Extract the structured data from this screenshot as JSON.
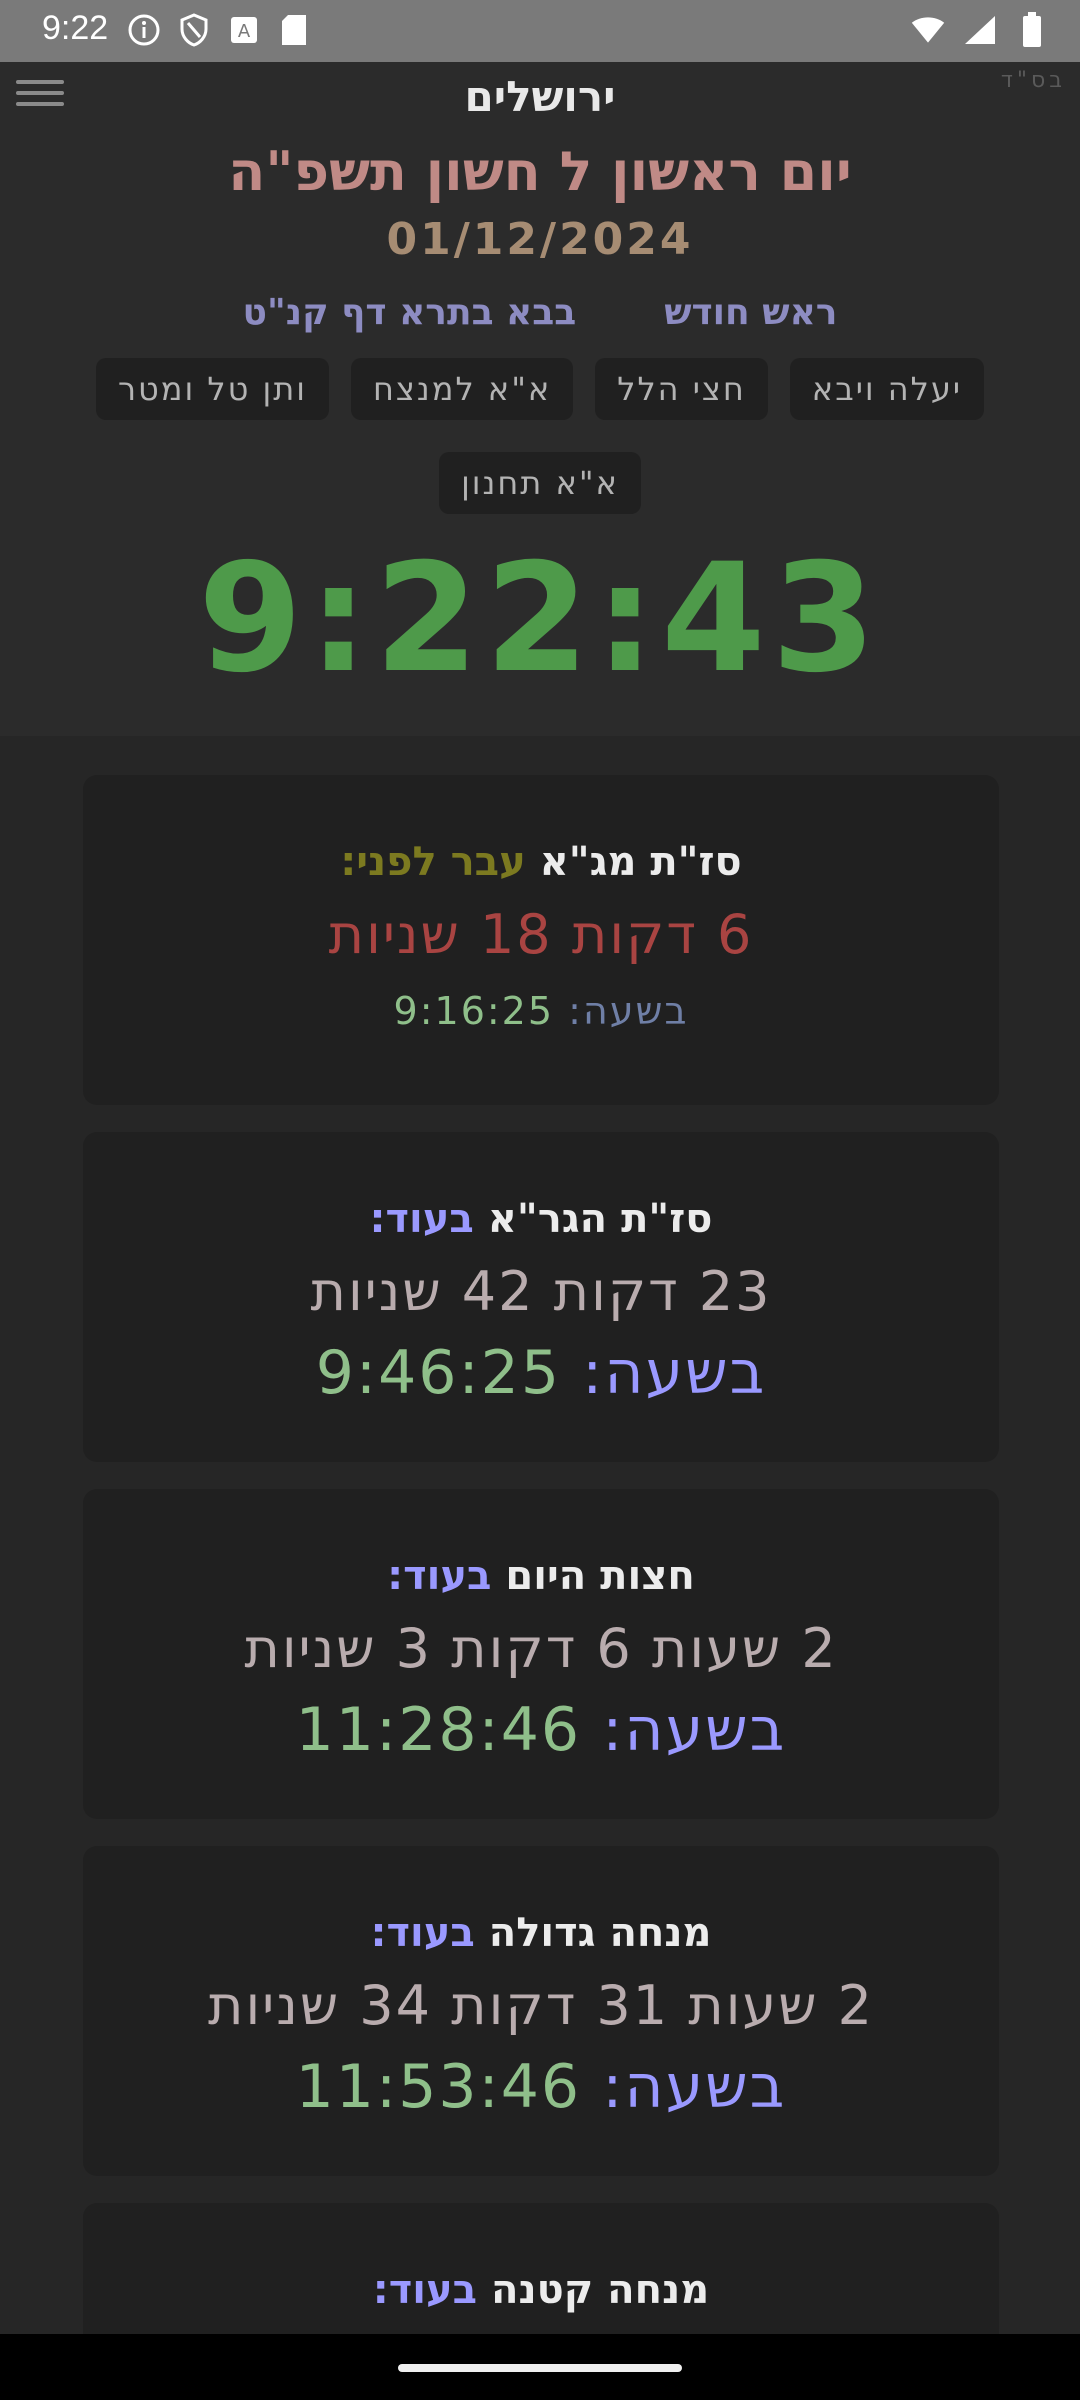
{
  "status_bar": {
    "time": "9:22",
    "left_icons": [
      "info-icon",
      "shield-icon",
      "a-square-icon",
      "sd-card-icon"
    ],
    "right_icons": [
      "wifi-icon",
      "signal-icon",
      "battery-icon"
    ]
  },
  "header": {
    "bsd": "בס\"ד",
    "city": "ירושלים",
    "hebrew_date": "יום ראשון ל חשון תשפ\"ה",
    "gregorian_date": "01/12/2024",
    "info": [
      "ראש חודש",
      "בבא בתרא דף קנ\"ט"
    ],
    "chips_row1": [
      "יעלה ויבא",
      "חצי הלל",
      "א\"א למנצח",
      "ותן טל ומטר"
    ],
    "chips_row2": [
      "א\"א תחנון"
    ],
    "clock": "9:22:43"
  },
  "cards": [
    {
      "name": "סז\"ת מג\"א",
      "status": "עבר לפני:",
      "remaining": "6 דקות 18 שניות",
      "at_label": "בשעה:",
      "at_time": "9:16:25"
    },
    {
      "name": "סז\"ת הגר\"א",
      "status": "בעוד:",
      "remaining": "23 דקות 42 שניות",
      "at_label": "בשעה:",
      "at_time": "9:46:25"
    },
    {
      "name": "חצות היום",
      "status": "בעוד:",
      "remaining": "2 שעות 6 דקות 3 שניות",
      "at_label": "בשעה:",
      "at_time": "11:28:46"
    },
    {
      "name": "מנחה גדולה",
      "status": "בעוד:",
      "remaining": "2 שעות 31 דקות 34 שניות",
      "at_label": "בשעה:",
      "at_time": "11:53:46"
    },
    {
      "name": "מנחה קטנה",
      "status": "בעוד:"
    }
  ],
  "colors": {
    "accent_upcoming": "#9a99ff",
    "past_label": "#7c7a20",
    "past_remaining": "#a94442",
    "time_green": "#4e9a4a",
    "hebrew_date": "#c08a86"
  }
}
